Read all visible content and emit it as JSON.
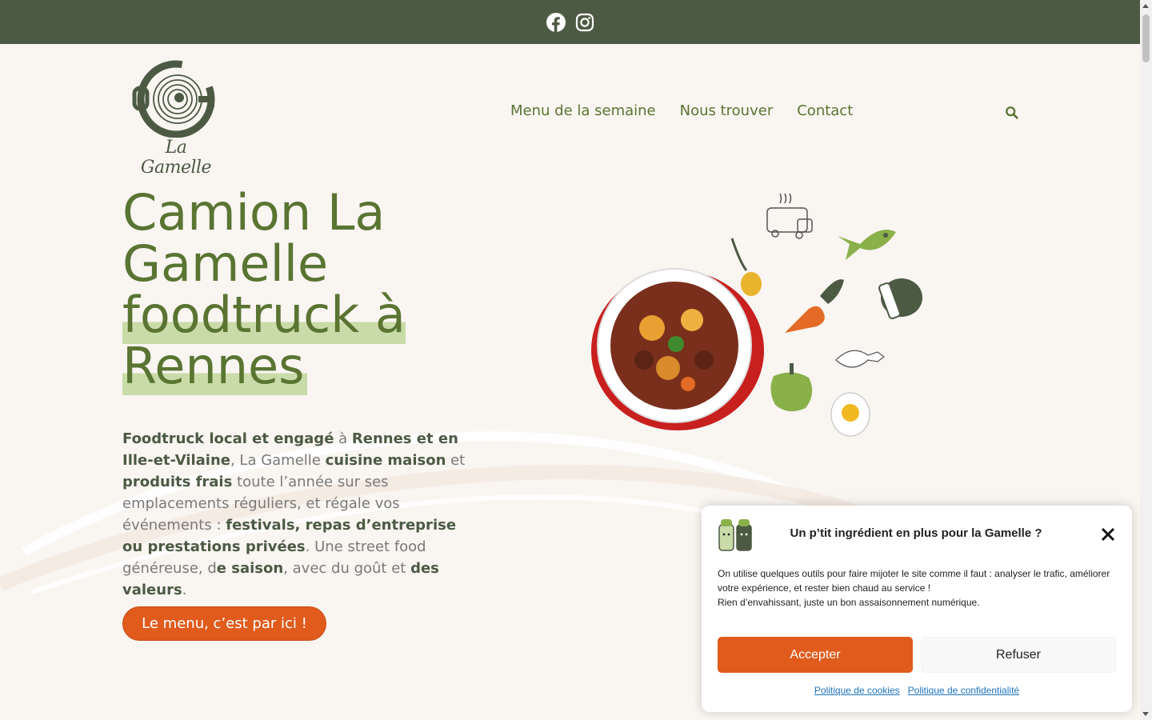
{
  "header": {
    "social": [
      "facebook-icon",
      "instagram-icon"
    ],
    "logo_text": "La Gamelle"
  },
  "nav": {
    "items": [
      {
        "label": "Menu de la semaine"
      },
      {
        "label": "Nous trouver"
      },
      {
        "label": "Contact"
      }
    ]
  },
  "hero": {
    "title_line1": "Camion La Gamelle",
    "title_line2": "foodtruck à Rennes",
    "intro": [
      {
        "text": "Foodtruck local et engagé",
        "bold": true
      },
      {
        "text": " à ",
        "bold": false
      },
      {
        "text": "Rennes et en Ille-et-Vilaine",
        "bold": true
      },
      {
        "text": ", La Gamelle ",
        "bold": false
      },
      {
        "text": "cuisine maison",
        "bold": true
      },
      {
        "text": " et ",
        "bold": false
      },
      {
        "text": "produits frais",
        "bold": true
      },
      {
        "text": " toute l’année sur ses emplacements réguliers, et régale vos événements : ",
        "bold": false
      },
      {
        "text": "festivals, repas d’entreprise ou prestations privées",
        "bold": true
      },
      {
        "text": ". Une street food généreuse, d",
        "bold": false
      },
      {
        "text": "e saison",
        "bold": true
      },
      {
        "text": ", avec du goût et ",
        "bold": false
      },
      {
        "text": "des valeurs",
        "bold": true
      },
      {
        "text": ".",
        "bold": false
      }
    ],
    "cta_label": "Le menu, c’est par ici !"
  },
  "cookie": {
    "title": "Un p’tit ingrédient en plus pour la Gamelle ?",
    "text_line1": "On utilise quelques outils pour faire mijoter le site comme il faut : analyser le trafic, améliorer votre expérience, et rester bien chaud au service !",
    "text_line2": "Rien d’envahissant, juste un bon assaisonnement numérique.",
    "accept_label": "Accepter",
    "refuse_label": "Refuser",
    "link_cookies": "Politique de cookies",
    "link_privacy": "Politique de confidentialité"
  },
  "colors": {
    "topbar": "#4c5a43",
    "accent_green": "#5a7432",
    "highlight": "#c9dba8",
    "orange": "#e05b1c",
    "background": "#f9f5f1"
  }
}
